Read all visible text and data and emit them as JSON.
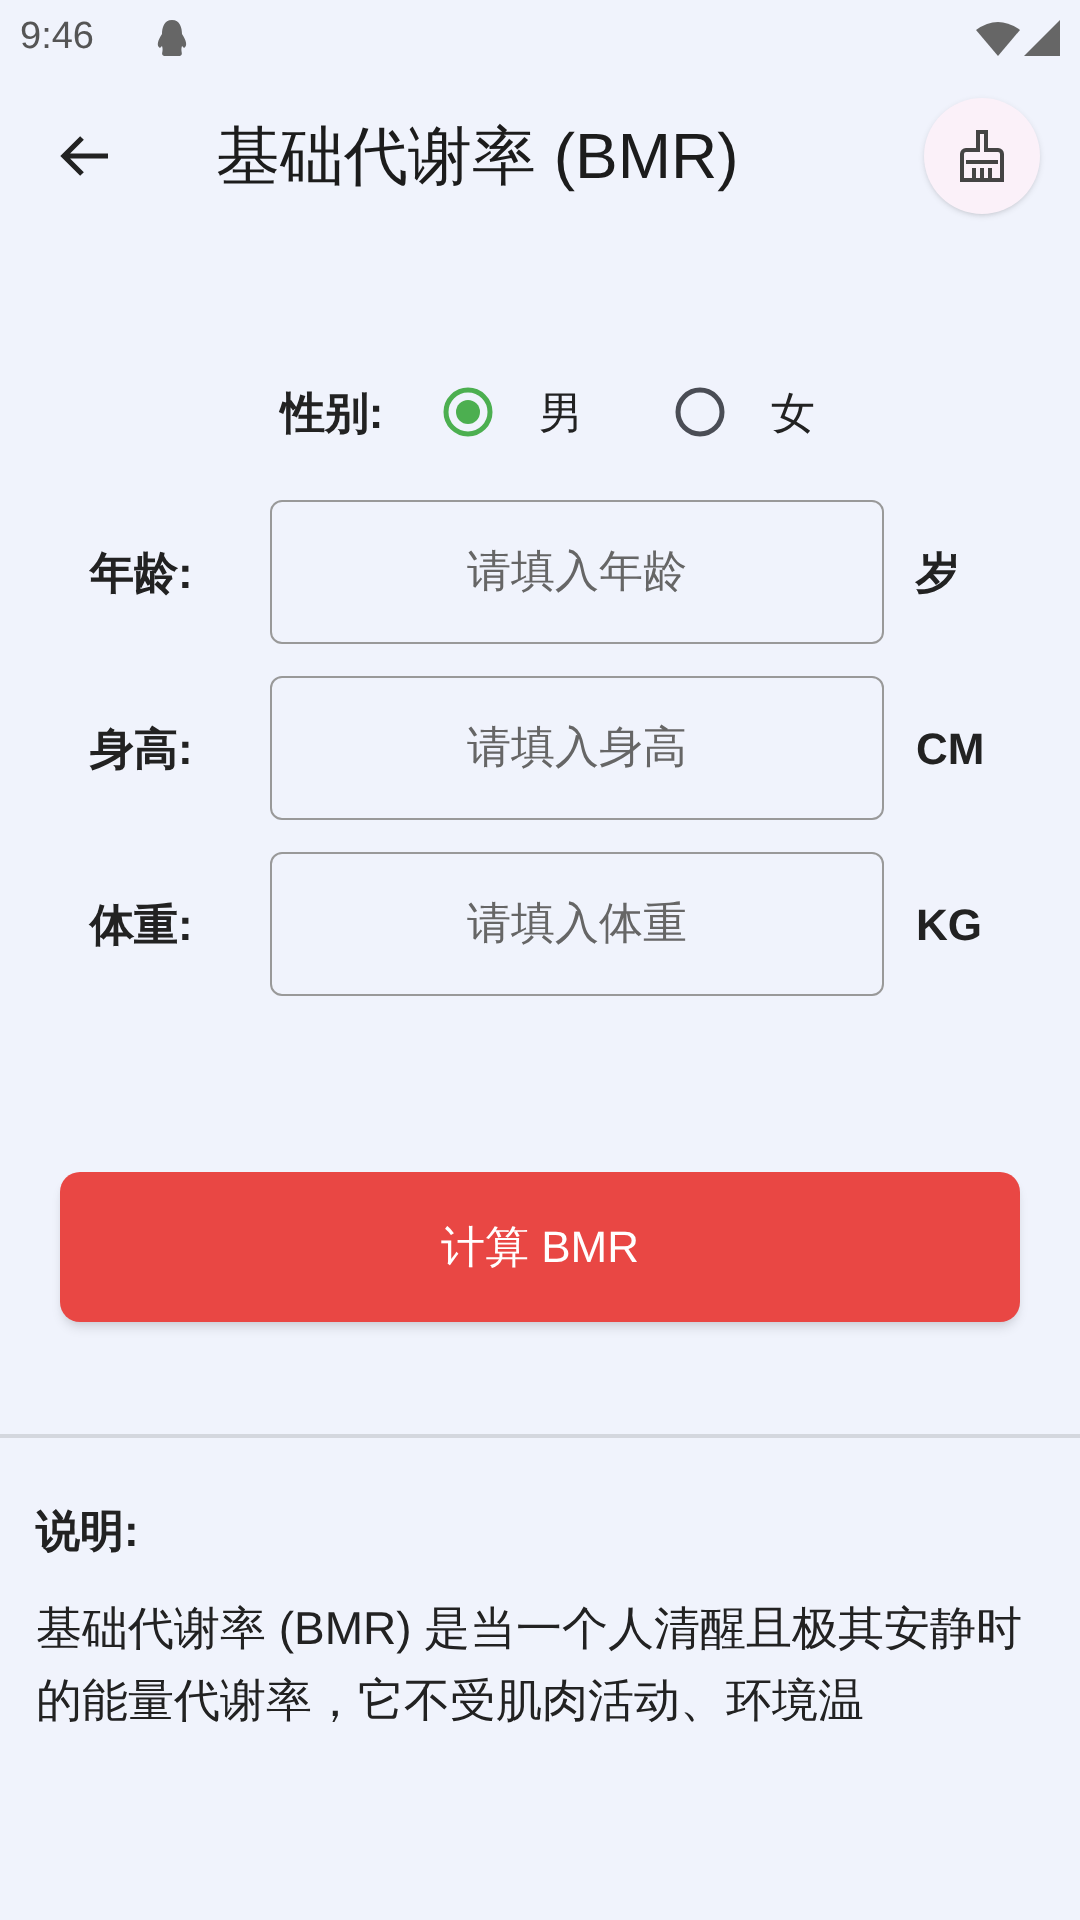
{
  "status_bar": {
    "time": "9:46"
  },
  "app_bar": {
    "title": "基础代谢率 (BMR)"
  },
  "gender": {
    "label": "性别:",
    "options": [
      {
        "label": "男",
        "selected": true
      },
      {
        "label": "女",
        "selected": false
      }
    ]
  },
  "fields": [
    {
      "label": "年龄:",
      "placeholder": "请填入年龄",
      "unit": "岁"
    },
    {
      "label": "身高:",
      "placeholder": "请填入身高",
      "unit": "CM"
    },
    {
      "label": "体重:",
      "placeholder": "请填入体重",
      "unit": "KG"
    }
  ],
  "calculate_button": "计算 BMR",
  "description": {
    "heading": "说明:",
    "text": "基础代谢率 (BMR) 是当一个人清醒且极其安静时的能量代谢率，它不受肌肉活动、环境温"
  }
}
